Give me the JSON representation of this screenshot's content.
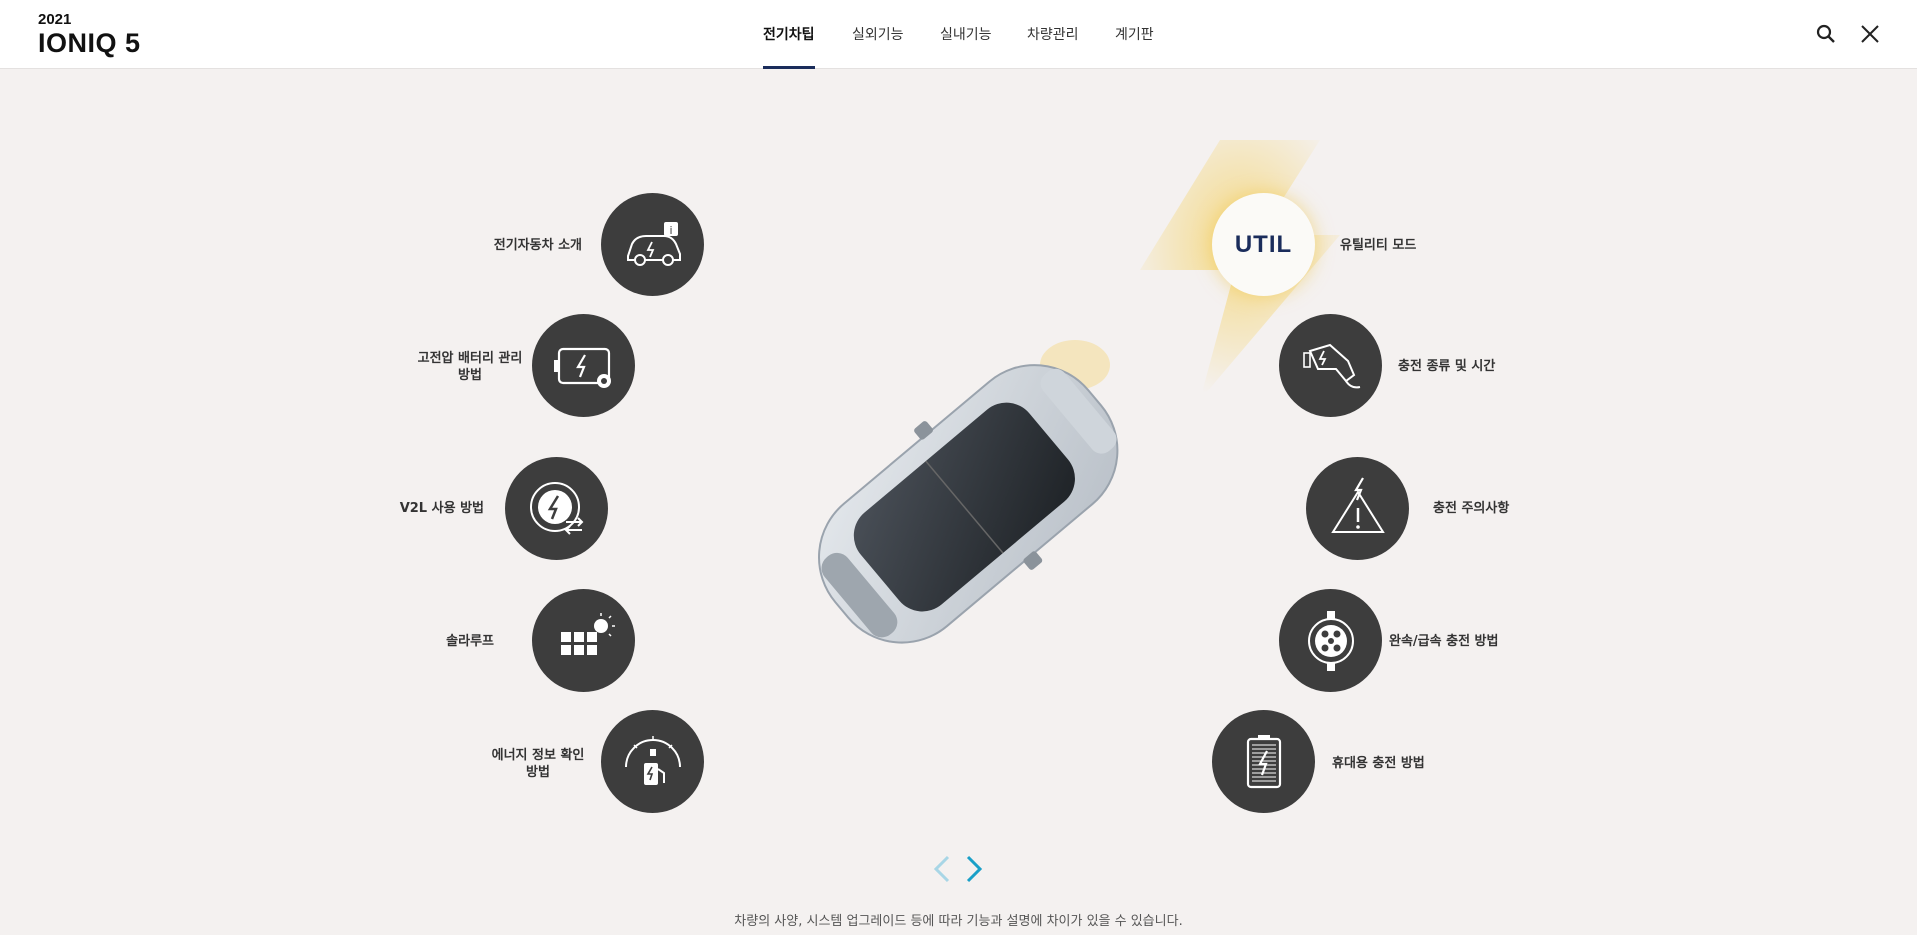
{
  "header": {
    "year": "2021",
    "model": "IONIQ 5",
    "tabs": [
      {
        "label": "전기차팁",
        "active": true
      },
      {
        "label": "실외기능",
        "active": false
      },
      {
        "label": "실내기능",
        "active": false
      },
      {
        "label": "차량관리",
        "active": false
      },
      {
        "label": "계기판",
        "active": false
      }
    ],
    "search_icon": "search-icon",
    "close_icon": "close-icon"
  },
  "features_left": [
    {
      "label": "전기자동차 소개",
      "icon": "ev-info-icon"
    },
    {
      "label_line1": "고전압 배터리 관리",
      "label_line2": "방법",
      "icon": "battery-settings-icon"
    },
    {
      "label": "V2L 사용 방법",
      "icon": "v2l-icon"
    },
    {
      "label": "솔라루프",
      "icon": "solar-roof-icon"
    },
    {
      "label_line1": "에너지 정보 확인",
      "label_line2": "방법",
      "icon": "energy-gauge-icon"
    }
  ],
  "features_right": [
    {
      "label": "유틸리티 모드",
      "icon_text": "UTIL",
      "highlighted": true
    },
    {
      "label": "충전 종류 및 시간",
      "icon": "charging-plug-icon"
    },
    {
      "label": "충전 주의사항",
      "icon": "warning-icon"
    },
    {
      "label": "완속/급속 충전 방법",
      "icon": "charge-port-icon"
    },
    {
      "label": "휴대용 충전 방법",
      "icon": "portable-charger-icon"
    }
  ],
  "pager": {
    "prev_icon": "chevron-left-icon",
    "next_icon": "chevron-right-icon"
  },
  "footnote": "차량의 사양, 시스템 업그레이드 등에 따라 기능과 설명에 차이가 있을 수 있습니다.",
  "colors": {
    "accent": "#1a2c5b",
    "circle": "#3d3d3d",
    "highlight": "#f2d27a",
    "arrow_active": "#1aa0c8",
    "arrow_inactive": "#a8d6e6"
  }
}
